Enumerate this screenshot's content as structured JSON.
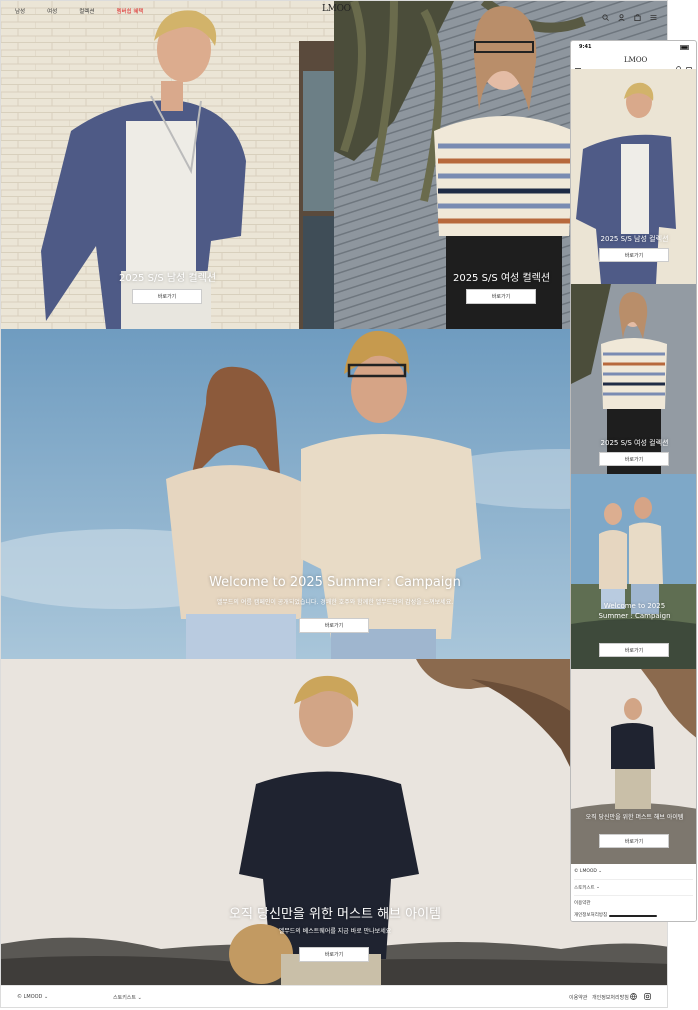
{
  "nav": {
    "links": [
      "남성",
      "여성",
      "컬렉션",
      "멤버쉽 혜택"
    ],
    "logo": "LMOO",
    "icons": [
      "search-icon",
      "user-icon",
      "bag-icon",
      "menu-icon"
    ]
  },
  "hero_men": {
    "title": "2025 S/S 남성 컬렉션",
    "button": "바로가기"
  },
  "hero_women": {
    "title": "2025 S/S 여성 컬렉션",
    "button": "바로가기"
  },
  "campaign": {
    "title": "Welcome to 2025 Summer : Campaign",
    "subtitle": "엘무드의 여름 캠페인이 공개되었습니다. 경쾌한 호주와 함께한 엘무드만의 감성을 느껴보세요.",
    "button": "바로가기"
  },
  "must_have": {
    "title": "오직 당신만을 위한 머스트 해브 아이템",
    "subtitle": "엘무드의 베스트웨어를 지금 바로 만나보세요",
    "button": "바로가기"
  },
  "footer": {
    "brand": "© LMOOD",
    "family_site": "스토키스트",
    "terms": "이용약관",
    "privacy": "개인정보처리방침"
  },
  "mobile": {
    "time": "9:41",
    "logo": "LMOO",
    "hero_men": {
      "title": "2025 S/S 남성 컬렉션",
      "button": "바로가기"
    },
    "hero_women": {
      "title": "2025 S/S 여성 컬렉션",
      "button": "바로가기"
    },
    "campaign": {
      "title_line1": "Welcome to 2025",
      "title_line2": "Summer : Campaign",
      "button": "바로가기"
    },
    "must_have": {
      "title": "오직 당신만을 위한 머스트 해브 아이템",
      "button": "바로가기"
    },
    "footer": {
      "brand": "© LMOOD",
      "family_site": "스토키스트",
      "terms": "이용약관",
      "privacy": "개인정보처리방침"
    }
  },
  "colors": {
    "accent_red": "#dd2222",
    "sky": "#7fa9c9",
    "text": "#222222"
  }
}
